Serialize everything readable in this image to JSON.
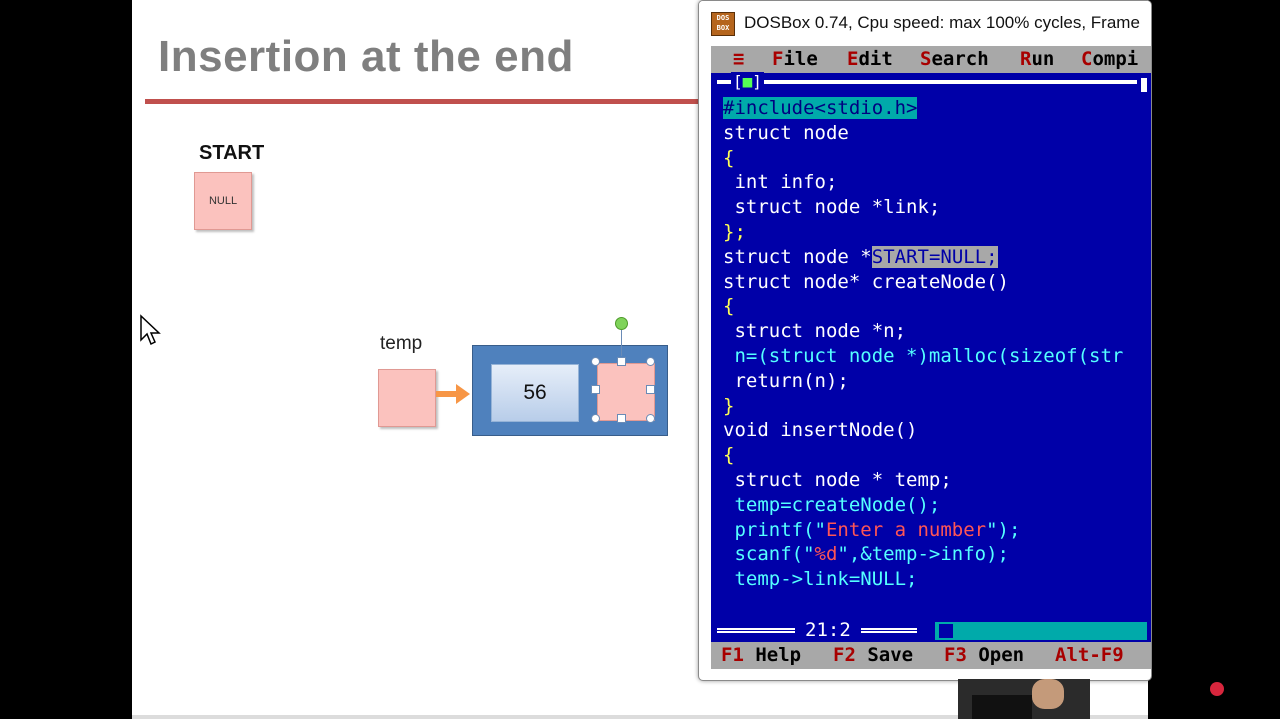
{
  "slide": {
    "title": "Insertion at the end",
    "start_label": "START",
    "start_value": "NULL",
    "temp_label": "temp",
    "node_info_value": "56"
  },
  "dosbox": {
    "window_title": "DOSBox 0.74, Cpu speed: max 100% cycles, Frame",
    "icon_text": "DOS BOX",
    "menu": {
      "system_icon": "≡",
      "file": {
        "hot": "F",
        "rest": "ile"
      },
      "edit": {
        "hot": "E",
        "rest": "dit"
      },
      "search": {
        "hot": "S",
        "rest": "earch"
      },
      "run": {
        "hot": "R",
        "rest": "un"
      },
      "compile": {
        "hot": "C",
        "rest": "ompi"
      }
    },
    "window_tag": "[■]",
    "code_lines": [
      "#include<stdio.h>",
      "struct node",
      "{",
      " int info;",
      " struct node *link;",
      "};",
      "struct node *START=NULL;",
      "struct node* createNode()",
      "{",
      " struct node *n;",
      " n=(struct node *)malloc(sizeof(str",
      " return(n);",
      "}",
      "void insertNode()",
      "{",
      " struct node * temp;",
      " temp=createNode();",
      " printf(\"Enter a number\");",
      " scanf(\"%d\",&temp->info);",
      " temp->link=NULL;"
    ],
    "cursor_position": "21:2",
    "status": {
      "f1_key": "F1",
      "f1_label": "Help",
      "f2_key": "F2",
      "f2_label": "Save",
      "f3_key": "F3",
      "f3_label": "Open",
      "alt_key": "Alt-F9"
    }
  },
  "colors": {
    "dos_blue": "#0000a8",
    "dos_cyan": "#55ffff",
    "title_rule": "#c0504d",
    "node_blue": "#4f81bd",
    "pink_box": "#fbc2be"
  }
}
